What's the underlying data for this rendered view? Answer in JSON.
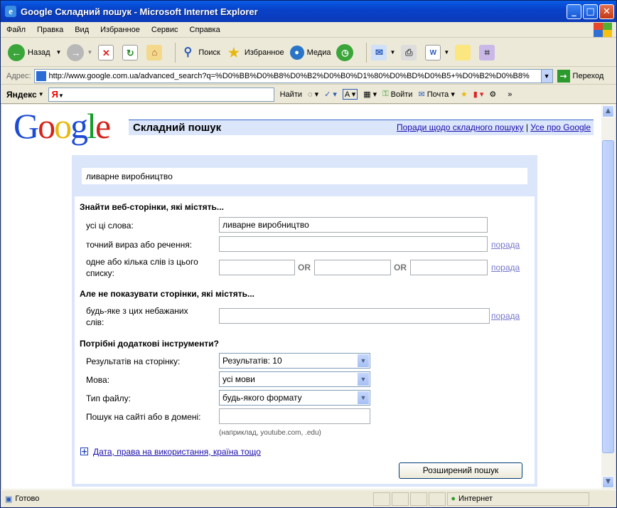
{
  "window": {
    "title": "Google Складний пошук - Microsoft Internet Explorer"
  },
  "menu": [
    "Файл",
    "Правка",
    "Вид",
    "Избранное",
    "Сервис",
    "Справка"
  ],
  "toolbar": {
    "back": "Назад",
    "search": "Поиск",
    "favorites": "Избранное",
    "media": "Медиа"
  },
  "address": {
    "label": "Адрес:",
    "url": "http://www.google.com.ua/advanced_search?q=%D0%BB%D0%B8%D0%B2%D0%B0%D1%80%D0%BD%D0%B5+%D0%B2%D0%B8%",
    "go": "Переход"
  },
  "yandex": {
    "brand_black": "Яндекс",
    "box_text": "Я",
    "find": "Найти",
    "login": "Войти",
    "mail": "Почта"
  },
  "page": {
    "title": "Складний пошук",
    "link_tips": "Поради щодо складного пошуку",
    "link_sep": "|",
    "link_about": "Усе про Google",
    "query": "ливарне виробництво",
    "find_pages_heading": "Знайти веб-сторінки, які містять...",
    "all_words_label": "усі ці слова:",
    "all_words_value": "ливарне виробництво",
    "exact_label": "точний вираз або речення:",
    "any_label_1": "одне або кілька слів із цього",
    "any_label_2": "списку:",
    "or_text": "OR",
    "tip": "порада",
    "exclude_heading": "Але не показувати сторінки, які містять...",
    "exclude_label_1": "будь-яке з цих небажаних",
    "exclude_label_2": "слів:",
    "tools_heading": "Потрібні додаткові інструменти?",
    "results_label": "Результатів на сторінку:",
    "results_value": "Результатів: 10",
    "language_label": "Мова:",
    "language_value": "усі мови",
    "filetype_label": "Тип файлу:",
    "filetype_value": "будь-якого формату",
    "site_label": "Пошук на сайті або в домені:",
    "site_hint": "(наприклад, youtube.com, .edu)",
    "more_link": "Дата, права на використання, країна тощо",
    "submit": "Розширений пошук"
  },
  "status": {
    "left": "Готово",
    "zone": "Интернет"
  }
}
